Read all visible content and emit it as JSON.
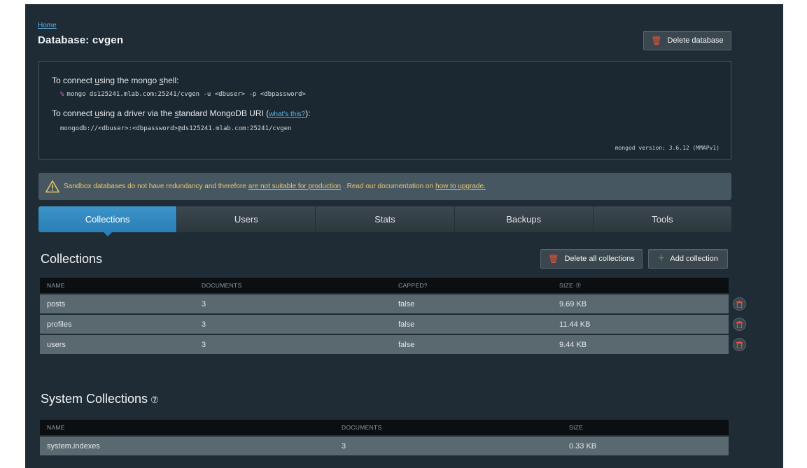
{
  "breadcrumb": {
    "home": "Home"
  },
  "page": {
    "title": "Database: cvgen"
  },
  "header": {
    "delete_db_label": "Delete database"
  },
  "connect": {
    "shell_label_pre": "To connect ",
    "shell_label_u": "u",
    "shell_label_post": "sing the mongo ",
    "shell_label_s": "s",
    "shell_label_end": "hell:",
    "shell_prompt": "%",
    "shell_command": "mongo ds125241.mlab.com:25241/cvgen -u <dbuser> -p <dbpassword>",
    "driver_label_pre": "To connect ",
    "driver_label_u": "u",
    "driver_label_mid": "sing a driver via the ",
    "driver_label_s": "s",
    "driver_label_post": "tandard MongoDB URI (",
    "driver_link": "what's this?",
    "driver_label_end": "):",
    "uri": "mongodb://<dbuser>:<dbpassword>@ds125241.mlab.com:25241/cvgen",
    "version": "mongod version: 3.6.12 (MMAPv1)"
  },
  "warning": {
    "text_pre": "Sandbox databases do not have redundancy and therefore",
    "link1": "are not suitable for production",
    "text_mid": ". Read our documentation on",
    "link2": "how to upgrade."
  },
  "tabs": [
    {
      "label": "Collections",
      "active": true
    },
    {
      "label": "Users",
      "active": false
    },
    {
      "label": "Stats",
      "active": false
    },
    {
      "label": "Backups",
      "active": false
    },
    {
      "label": "Tools",
      "active": false
    }
  ],
  "collections": {
    "title": "Collections",
    "delete_all_label": "Delete all collections",
    "add_label": "Add collection",
    "columns": {
      "name": "NAME",
      "documents": "DOCUMENTS",
      "capped": "CAPPED?",
      "size": "SIZE",
      "size_help": "⑦"
    },
    "rows": [
      {
        "name": "posts",
        "documents": "3",
        "capped": "false",
        "size": "9.69 KB"
      },
      {
        "name": "profiles",
        "documents": "3",
        "capped": "false",
        "size": "11.44 KB"
      },
      {
        "name": "users",
        "documents": "3",
        "capped": "false",
        "size": "9.44 KB"
      }
    ]
  },
  "system_collections": {
    "title": "System Collections",
    "help": "⑦",
    "columns": {
      "name": "NAME",
      "documents": "DOCUMENTS",
      "size": "SIZE"
    },
    "rows": [
      {
        "name": "system.indexes",
        "documents": "3",
        "size": "0.33 KB"
      }
    ]
  },
  "colors": {
    "background": "#1f2c36",
    "accent": "#2a7fb6",
    "danger": "#e8553d",
    "success": "#47b34a",
    "warning": "#e6c66c"
  }
}
